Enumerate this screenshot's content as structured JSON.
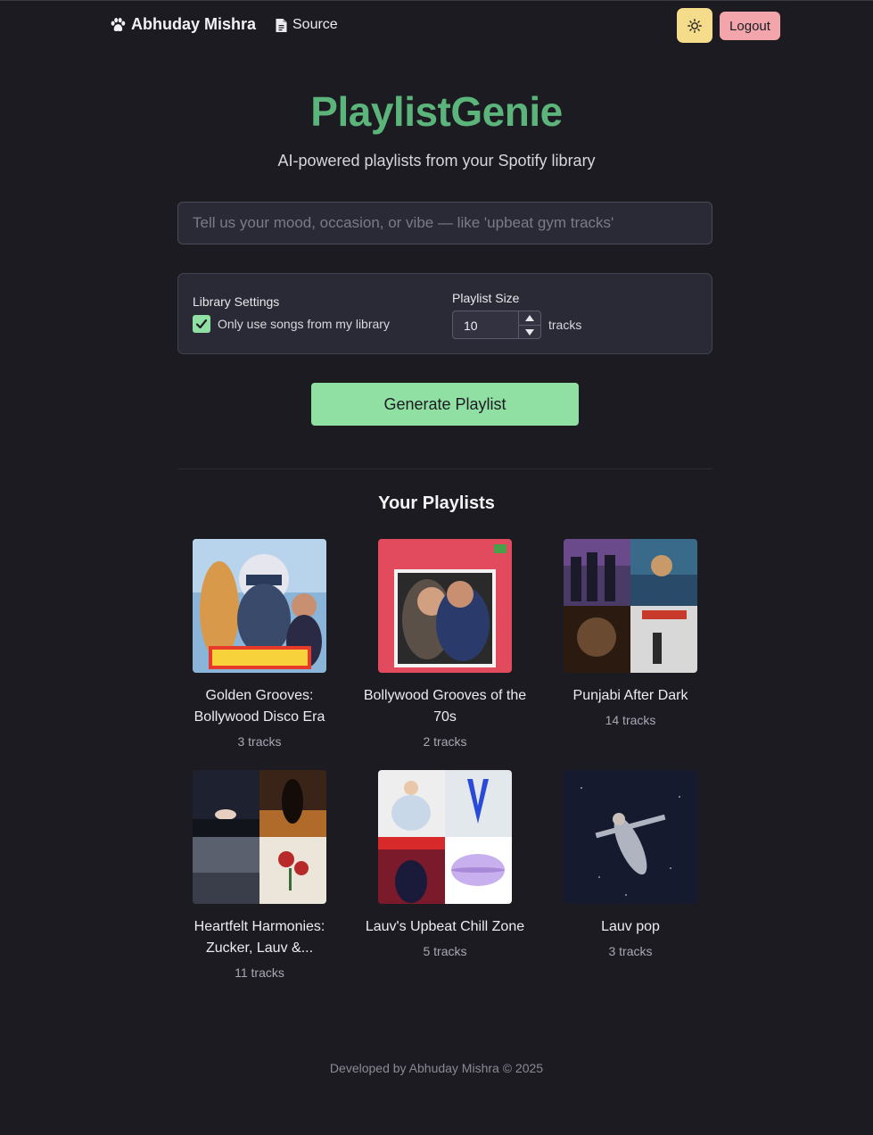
{
  "nav": {
    "brand": "Abhuday Mishra",
    "source_label": "Source",
    "logout_label": "Logout"
  },
  "hero": {
    "title": "PlaylistGenie",
    "subtitle": "AI-powered playlists from your Spotify library"
  },
  "prompt": {
    "placeholder": "Tell us your mood, occasion, or vibe — like 'upbeat gym tracks'",
    "value": ""
  },
  "settings": {
    "library_label": "Library Settings",
    "library_checkbox_label": "Only use songs from my library",
    "library_checked": true,
    "size_label": "Playlist Size",
    "size_value": "10",
    "size_unit": "tracks"
  },
  "generate_label": "Generate Playlist",
  "playlists_heading": "Your Playlists",
  "playlists": [
    {
      "name": "Golden Grooves: Bollywood Disco Era",
      "count": "3 tracks",
      "cover_color": "#8ab4d8"
    },
    {
      "name": "Bollywood Grooves of the 70s",
      "count": "2 tracks",
      "cover_color": "#e24a5e"
    },
    {
      "name": "Punjabi After Dark",
      "count": "14 tracks",
      "cover_color": "#4a3a66"
    },
    {
      "name": "Heartfelt Harmonies: Zucker, Lauv &...",
      "count": "11 tracks",
      "cover_color": "#2a2c36"
    },
    {
      "name": "Lauv's Upbeat Chill Zone",
      "count": "5 tracks",
      "cover_color": "#e8e8ee"
    },
    {
      "name": "Lauv pop",
      "count": "3 tracks",
      "cover_color": "#161a2e"
    }
  ],
  "footer": "Developed by Abhuday Mishra © 2025",
  "colors": {
    "background": "#1c1b22",
    "accent_green": "#5bb57a",
    "button_green": "#8fe0a2",
    "theme_button": "#f5dc8a",
    "logout_button": "#f2a6ac"
  },
  "icons": {
    "brand": "paw-icon",
    "source": "document-icon",
    "theme": "sun-icon",
    "checkbox": "check-icon"
  }
}
